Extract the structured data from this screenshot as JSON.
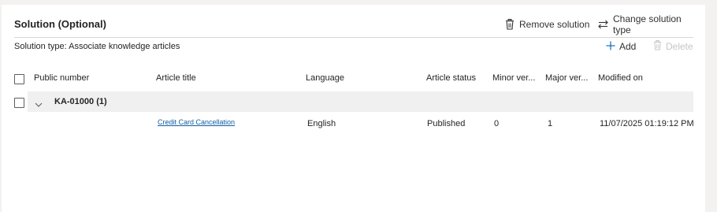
{
  "header": {
    "title": "Solution (Optional)",
    "remove_label": "Remove solution",
    "change_type_label": "Change solution type"
  },
  "subbar": {
    "solution_type": "Solution type: Associate knowledge articles",
    "add_label": "Add",
    "delete_label": "Delete"
  },
  "columns": {
    "public_number": "Public number",
    "article_title": "Article title",
    "language": "Language",
    "article_status": "Article status",
    "minor_version": "Minor ver...",
    "major_version": "Major ver...",
    "modified_on": "Modified on"
  },
  "group": {
    "label": "KA-01000 (1)"
  },
  "rows": [
    {
      "article_title": "Credit Card Cancellation",
      "language": "English",
      "article_status": "Published",
      "minor_version": "0",
      "major_version": "1",
      "modified_on": "11/07/2025 01:19:12 PM"
    }
  ],
  "icons": {
    "remove": "trash-icon",
    "change": "swap-arrows-icon",
    "add": "plus-icon",
    "delete": "trash-icon",
    "expand": "chevron-down-icon"
  },
  "colors": {
    "link": "#115ea3",
    "disabled": "#c8c6c4",
    "group_band": "#f0f0f0"
  }
}
